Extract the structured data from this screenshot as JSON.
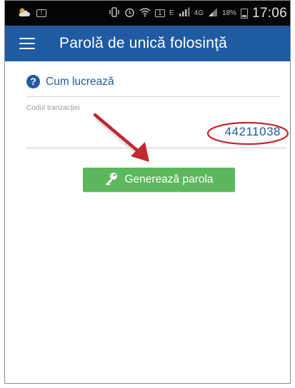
{
  "status_bar": {
    "time": "17:06",
    "network": "E",
    "network_4g": "4G",
    "battery": "18%"
  },
  "app_bar": {
    "title": "Parolă de unică folosinţă",
    "menu_icon": "hamburger-menu-icon"
  },
  "help": {
    "label": "Cum lucrează",
    "icon": "question-circle-icon"
  },
  "transaction": {
    "label": "Codul tranzacţiei",
    "value": "44211038"
  },
  "generate_button": {
    "label": "Generează parola",
    "icon": "key-icon"
  },
  "colors": {
    "primary": "#1f5aa3",
    "button": "#5cb85c",
    "annotation": "#c0282d"
  }
}
